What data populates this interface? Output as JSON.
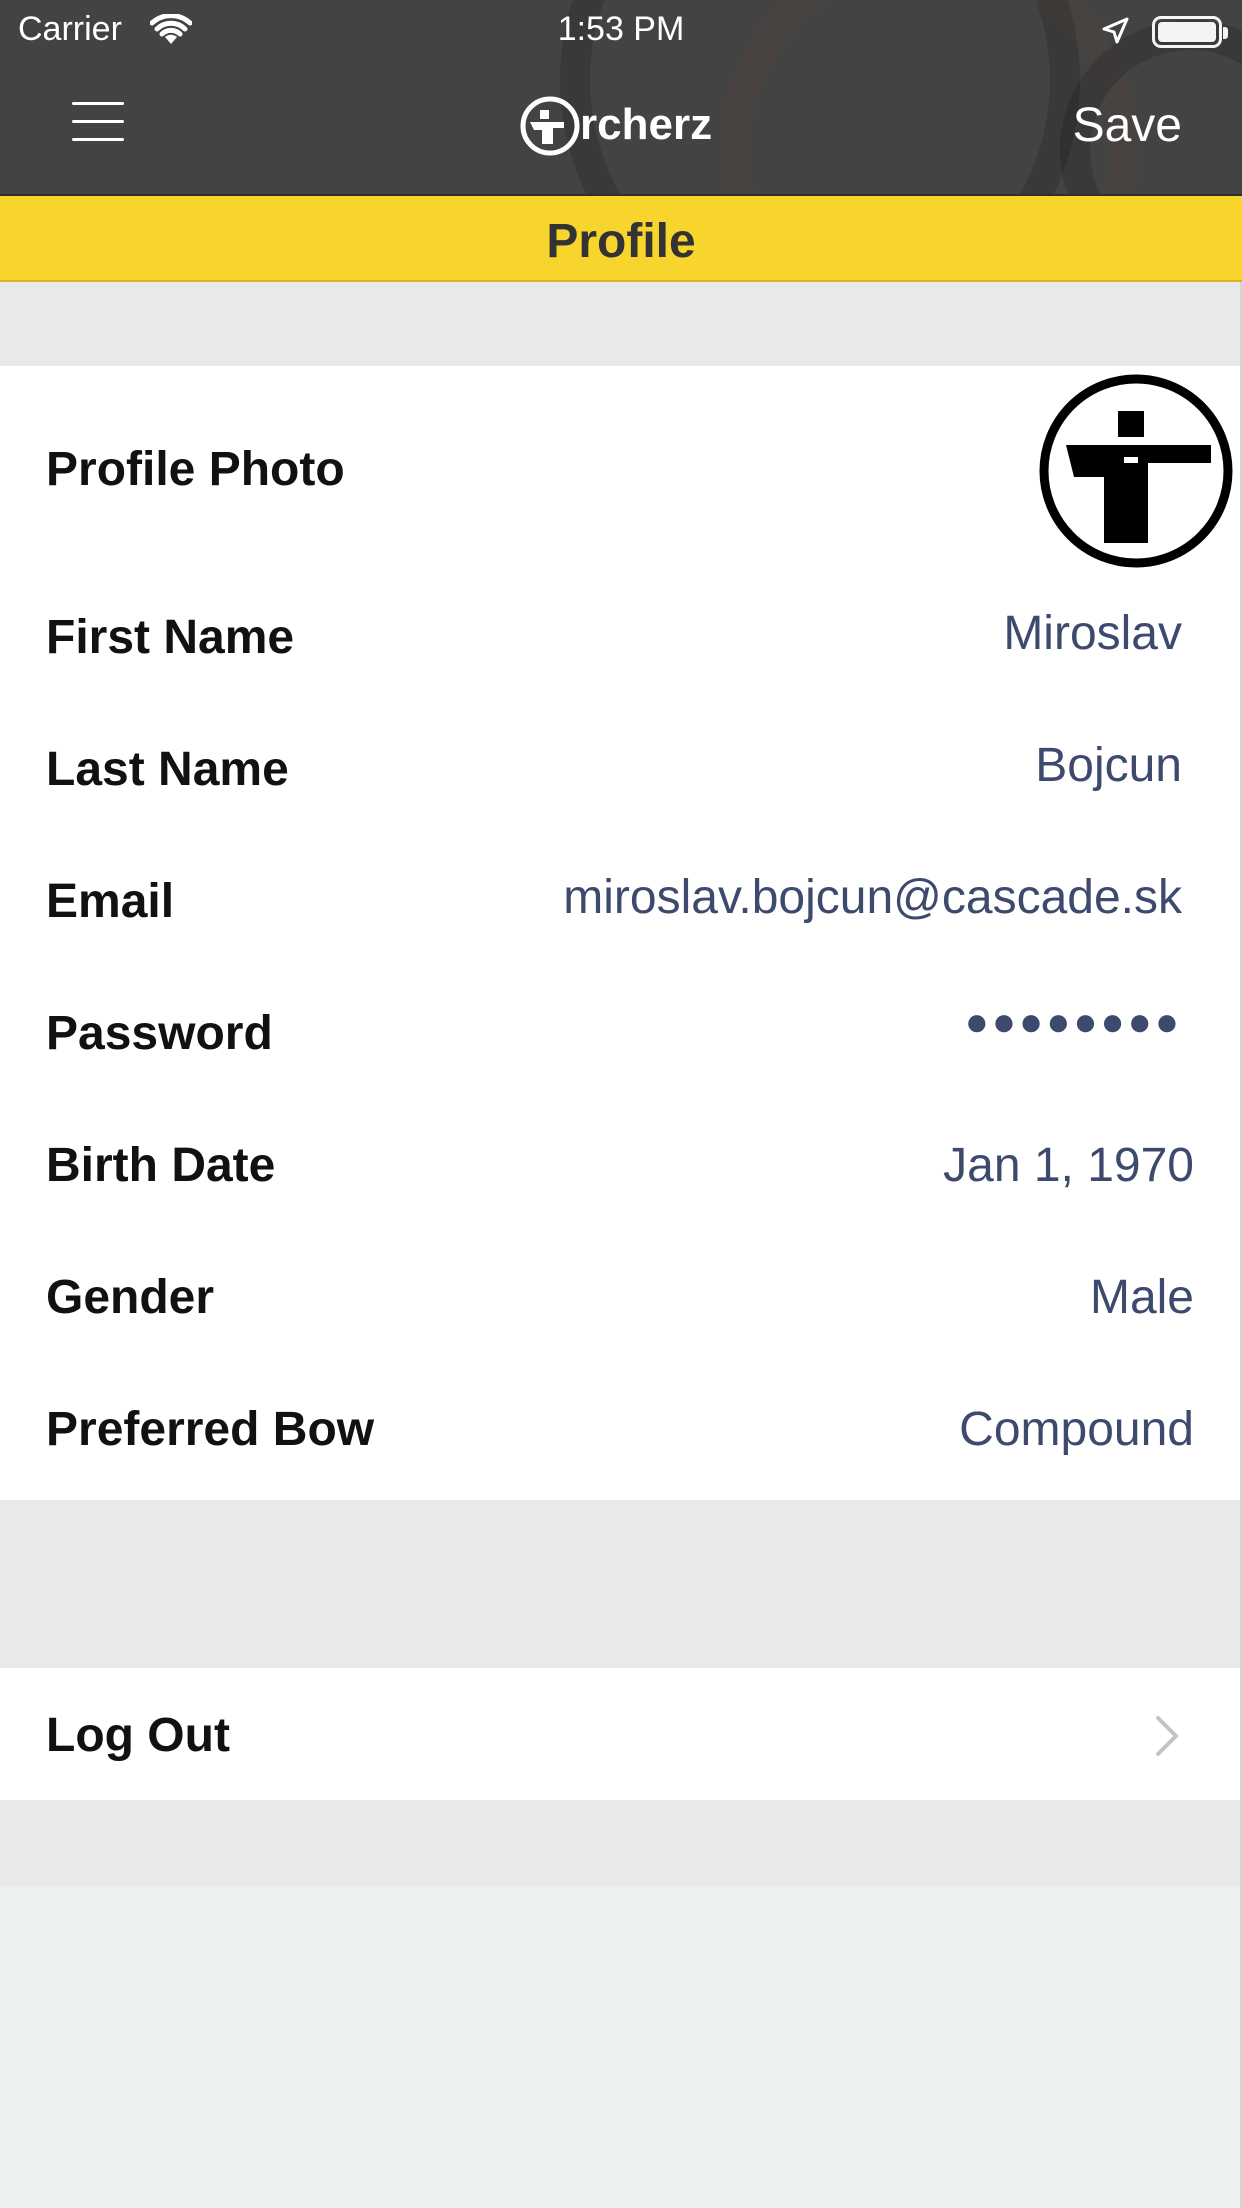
{
  "status_bar": {
    "carrier": "Carrier",
    "time": "1:53 PM",
    "icons": [
      "wifi-icon",
      "location-arrow-icon",
      "battery-icon"
    ]
  },
  "nav": {
    "menu_icon": "hamburger-menu-icon",
    "brand_logo_icon": "archer-logo-icon",
    "brand_text": "rcherz",
    "save_label": "Save"
  },
  "title": "Profile",
  "profile": {
    "photo_label": "Profile Photo",
    "photo_icon": "archer-avatar-icon",
    "fields": [
      {
        "label": "First Name",
        "value": "Miroslav"
      },
      {
        "label": "Last Name",
        "value": "Bojcun"
      },
      {
        "label": "Email",
        "value": "miroslav.bojcun@cascade.sk"
      },
      {
        "label": "Password",
        "value": "●●●●●●●●"
      },
      {
        "label": "Birth Date",
        "value": "Jan 1, 1970"
      },
      {
        "label": "Gender",
        "value": "Male"
      },
      {
        "label": "Preferred Bow",
        "value": "Compound"
      }
    ]
  },
  "logout": {
    "label": "Log Out",
    "icon": "chevron-right-icon"
  },
  "colors": {
    "nav_bg": "#434343",
    "accent_yellow": "#f8d52d",
    "value_text": "#3d4a6d",
    "group_gap": "#e9e9e9",
    "page_bg": "#ecf0f0"
  }
}
